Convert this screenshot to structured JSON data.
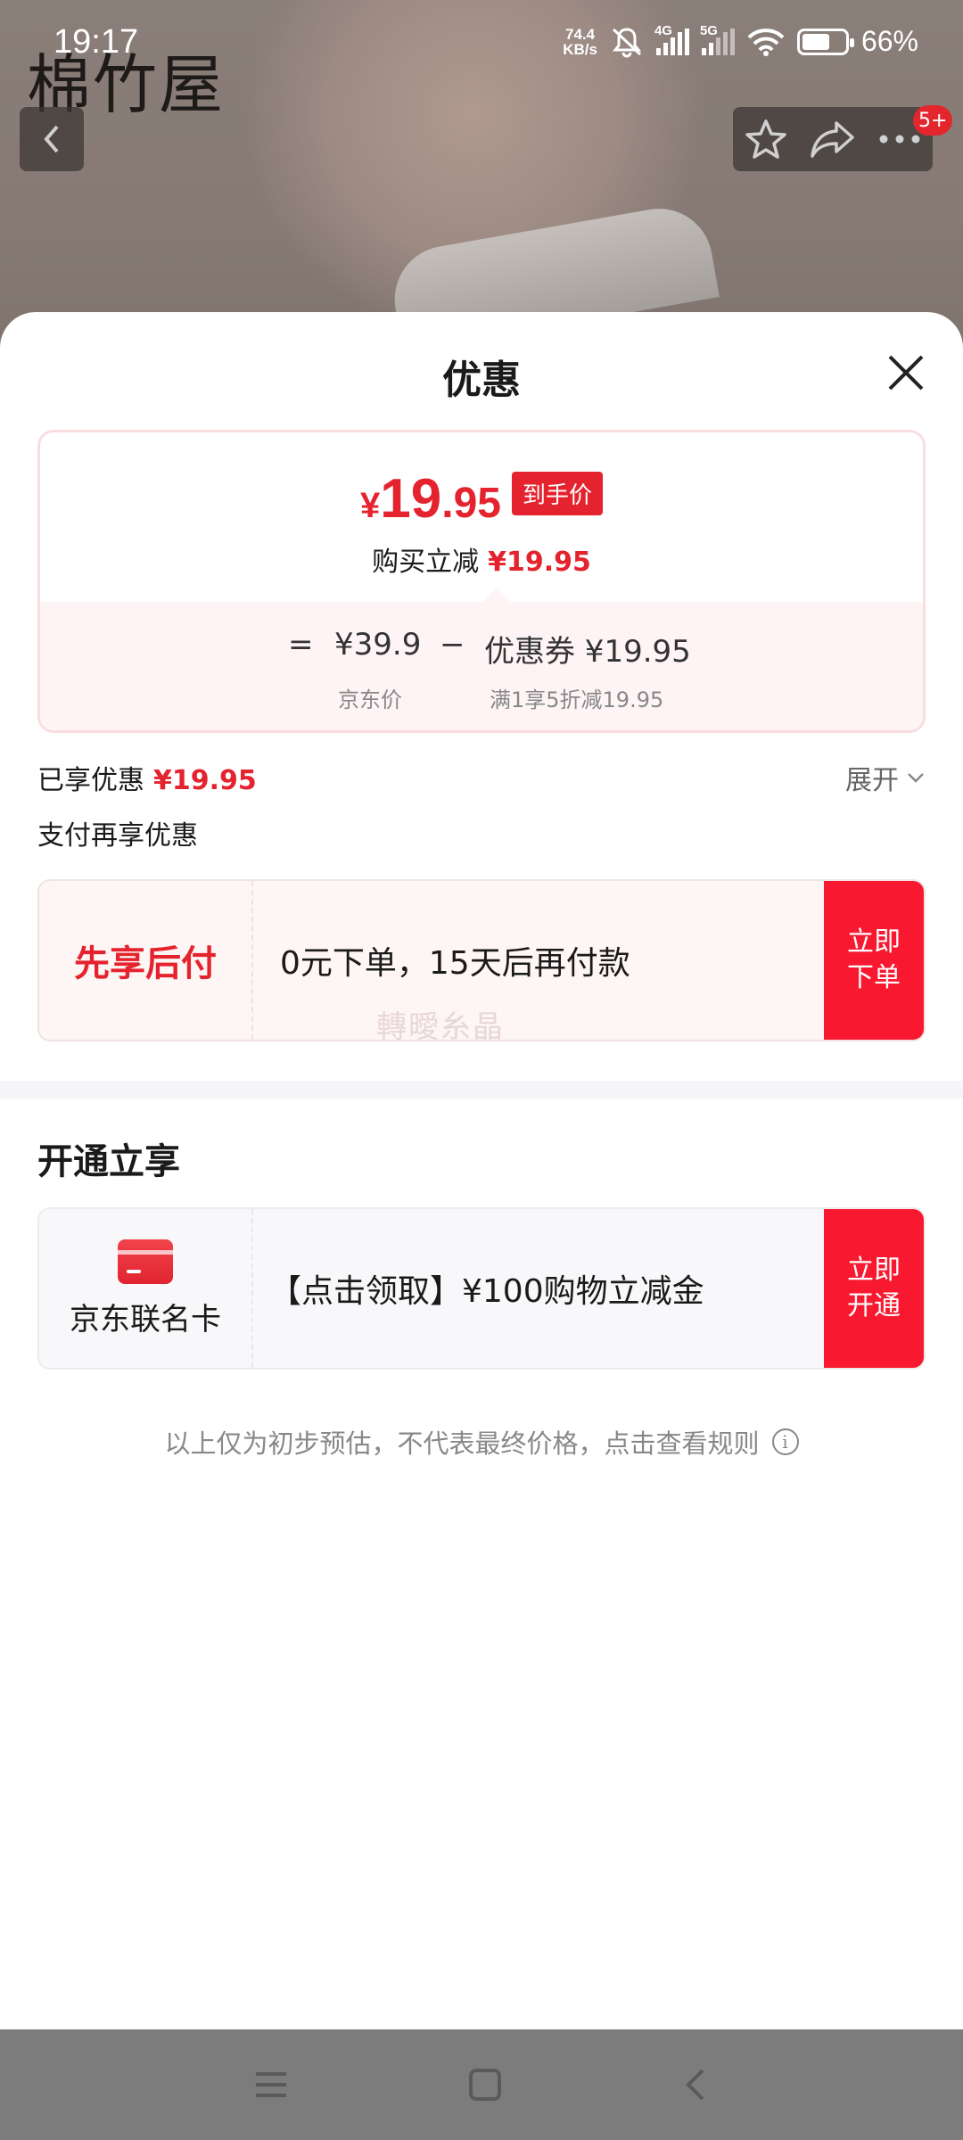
{
  "status_bar": {
    "time": "19:17",
    "net_speed_value": "74.4",
    "net_speed_unit": "KB/s",
    "signal_1_label": "4G",
    "signal_2_label": "5G",
    "battery_percent": "66%",
    "battery_level": 0.66
  },
  "background": {
    "brand_text": "棉竹屋",
    "cart_badge": "5+"
  },
  "sheet": {
    "title": "优惠",
    "price_card": {
      "currency": "¥",
      "price_int": "19",
      "price_dec": ".95",
      "price_tag": "到手价",
      "instant_discount_label": "购买立减",
      "instant_discount_value": "¥19.95",
      "equals": "=",
      "jd_price": "¥39.9",
      "minus": "−",
      "coupon_text": "优惠券 ¥19.95",
      "jd_price_label": "京东价",
      "coupon_rule": "满1享5折减19.95"
    },
    "enjoyed_label": "已享优惠",
    "enjoyed_value": "¥19.95",
    "expand_label": "展开",
    "pay_more_label": "支付再享优惠",
    "pay_later": {
      "title": "先享后付",
      "desc": "0元下单，15天后再付款",
      "cta": "立即下单",
      "watermark": "轉曖糸晶"
    },
    "open_section_title": "开通立享",
    "card_offer": {
      "name": "京东联名卡",
      "desc": "【点击领取】¥100购物立减金",
      "cta": "立即开通"
    },
    "disclaimer": "以上仅为初步预估，不代表最终价格，点击查看规则"
  },
  "colors": {
    "accent_red": "#e4232e",
    "cta_red": "#f8182f"
  }
}
